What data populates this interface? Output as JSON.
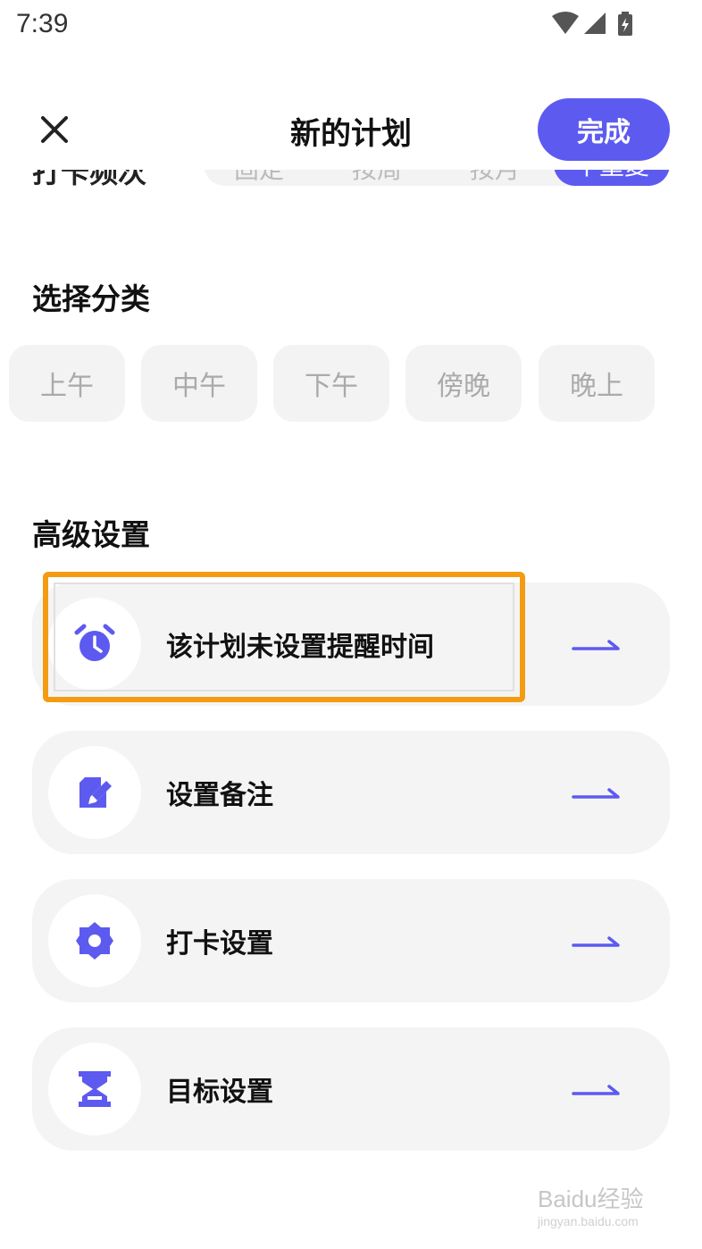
{
  "status_bar": {
    "time": "7:39",
    "icons": [
      "wifi-icon",
      "signal-icon",
      "battery-charging-icon"
    ]
  },
  "nav": {
    "close_icon": "close-icon",
    "title": "新的计划",
    "done_label": "完成"
  },
  "frequency": {
    "label": "打卡频次",
    "options": [
      "固定",
      "按周",
      "按月",
      "不重复"
    ]
  },
  "category": {
    "title": "选择分类",
    "chips": [
      "上午",
      "中午",
      "下午",
      "傍晚",
      "晚上"
    ]
  },
  "advanced": {
    "title": "高级设置",
    "items": [
      {
        "label": "该计划未设置提醒时间",
        "icon": "alarm-clock-icon"
      },
      {
        "label": "设置备注",
        "icon": "edit-note-icon"
      },
      {
        "label": "打卡设置",
        "icon": "gear-icon"
      },
      {
        "label": "目标设置",
        "icon": "hourglass-icon"
      }
    ]
  },
  "colors": {
    "accent": "#5d5af0",
    "highlight": "#f39c12",
    "row_bg": "#f4f4f4",
    "chip_text": "#aaaaaa"
  },
  "watermark": {
    "logo": "Baidu经验",
    "sub": "jingyan.baidu.com"
  }
}
